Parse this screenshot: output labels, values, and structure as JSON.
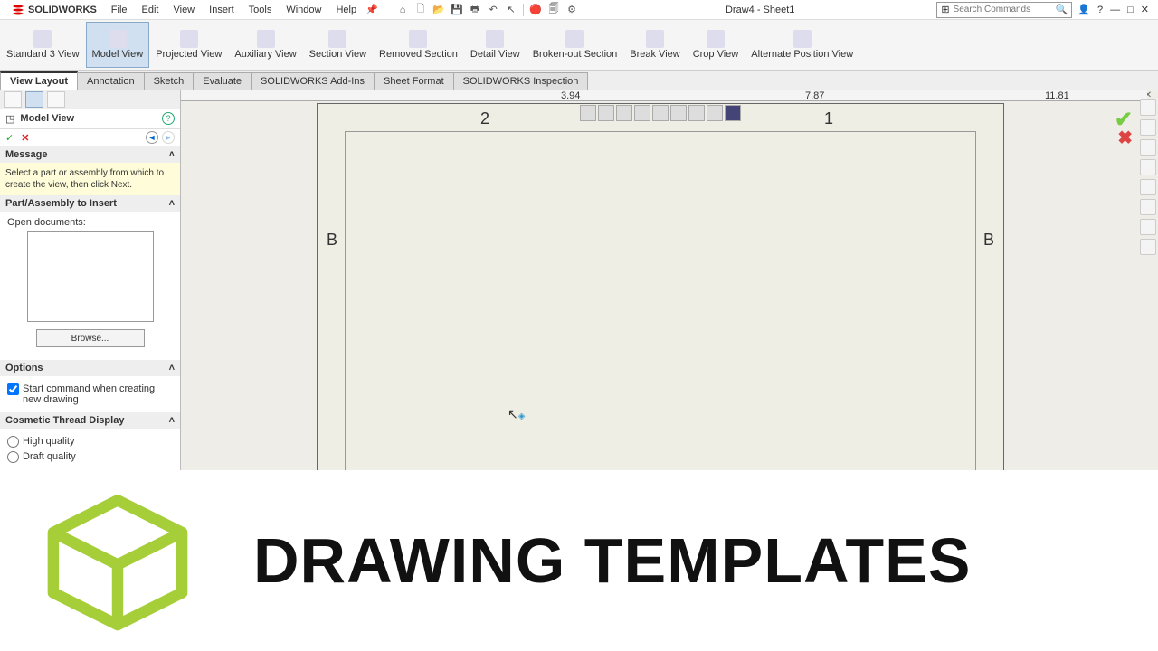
{
  "app_name": "SOLIDWORKS",
  "doc_title": "Draw4 - Sheet1",
  "menu": [
    "File",
    "Edit",
    "View",
    "Insert",
    "Tools",
    "Window",
    "Help"
  ],
  "search_placeholder": "Search Commands",
  "ribbon": [
    {
      "label": "Standard 3 View"
    },
    {
      "label": "Model View",
      "active": true
    },
    {
      "label": "Projected View"
    },
    {
      "label": "Auxiliary View"
    },
    {
      "label": "Section View"
    },
    {
      "label": "Removed Section"
    },
    {
      "label": "Detail View"
    },
    {
      "label": "Broken-out Section"
    },
    {
      "label": "Break View"
    },
    {
      "label": "Crop View"
    },
    {
      "label": "Alternate Position View"
    }
  ],
  "tabs": [
    "View Layout",
    "Annotation",
    "Sketch",
    "Evaluate",
    "SOLIDWORKS Add-Ins",
    "Sheet Format",
    "SOLIDWORKS Inspection"
  ],
  "active_tab": "View Layout",
  "panel": {
    "title": "Model View",
    "message_hdr": "Message",
    "message": "Select a part or assembly from which to create the view, then click Next.",
    "part_hdr": "Part/Assembly to Insert",
    "open_docs": "Open documents:",
    "browse": "Browse...",
    "options_hdr": "Options",
    "option1": "Start command when creating new drawing",
    "cosmetic_hdr": "Cosmetic Thread Display",
    "radio_hq": "High quality",
    "radio_dq": "Draft quality"
  },
  "ruler": {
    "l": "3.94",
    "m": "7.87",
    "r": "11.81"
  },
  "sheet": {
    "n2": "2",
    "n1": "1",
    "bL": "B",
    "bR": "B"
  },
  "banner_text": "DRAWING TEMPLATES"
}
